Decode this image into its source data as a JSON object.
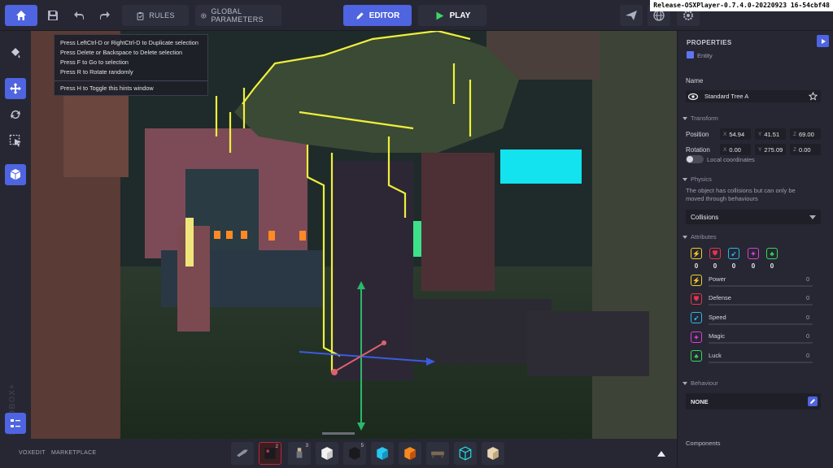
{
  "toolbar": {
    "rules_label": "RULES",
    "global_params_label": "GLOBAL PARAMETERS",
    "editor_label": "EDITOR",
    "play_label": "PLAY",
    "release_label": "Release-OSXPlayer-0.7.4.0-20220923 16-54cbf48"
  },
  "hints": {
    "lines": [
      "Press LeftCtrl-D or RightCtrl-D to Duplicate selection",
      "Press Delete or Backspace to Delete selection",
      "Press F to Go to selection",
      "Press R to Rotate randomly",
      "Press H to Toggle this hints window"
    ]
  },
  "sidebar": {
    "brand": "SANDBOX+"
  },
  "bottom": {
    "voxedit": "VOXEDIT",
    "marketplace": "MARKETPLACE",
    "slot_badges": {
      "s2": "2",
      "s3": "3",
      "s5": "5"
    }
  },
  "properties": {
    "title": "PROPERTIES",
    "subtitle": "Entity",
    "name_label": "Name",
    "name_value": "Standard Tree A",
    "transform_label": "Transform",
    "position_label": "Position",
    "position": {
      "x": "54.94",
      "y": "41.51",
      "z": "69.00"
    },
    "rotation_label": "Rotation",
    "rotation": {
      "x": "0.00",
      "y": "275.09",
      "z": "0.00"
    },
    "local_coords": "Local coordinates",
    "physics_label": "Physics",
    "physics_desc_1": "The object has collisions but can only be",
    "physics_desc_2": "moved through behaviours",
    "collisions_value": "Collisions",
    "attributes_label": "Attributes",
    "attributes": [
      {
        "name": "Power",
        "value": "0",
        "count": "0",
        "color": "#f1d02b",
        "glyph": "⚡"
      },
      {
        "name": "Defense",
        "value": "0",
        "count": "0",
        "color": "#e8344c",
        "glyph": "⛊"
      },
      {
        "name": "Speed",
        "value": "0",
        "count": "0",
        "color": "#2fb6e8",
        "glyph": "➹"
      },
      {
        "name": "Magic",
        "value": "0",
        "count": "0",
        "color": "#e03bd6",
        "glyph": "✦"
      },
      {
        "name": "Luck",
        "value": "0",
        "count": "0",
        "color": "#38d85a",
        "glyph": "♣"
      }
    ],
    "behaviour_label": "Behaviour",
    "behaviour_value": "NONE",
    "components_label": "Components"
  },
  "colors": {
    "accent": "#4f64e0",
    "panel": "#262733",
    "field": "#1e1f27",
    "selection": "#f0ef3a"
  }
}
